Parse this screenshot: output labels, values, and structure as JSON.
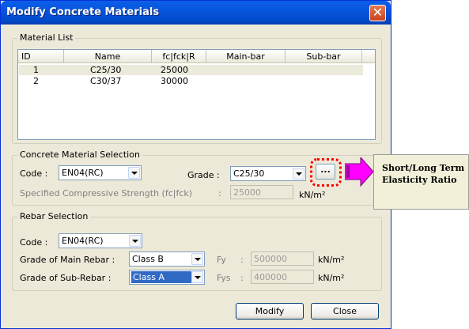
{
  "window": {
    "title": "Modify Concrete Materials",
    "close_glyph": "✕"
  },
  "material_list": {
    "group_label": "Material List",
    "columns": [
      "ID",
      "Name",
      "fc|fck|R",
      "Main-bar",
      "Sub-bar"
    ],
    "rows": [
      {
        "id": "1",
        "name": "C25/30",
        "fc": "25000",
        "main": "",
        "sub": ""
      },
      {
        "id": "2",
        "name": "C30/37",
        "fc": "30000",
        "main": "",
        "sub": ""
      }
    ]
  },
  "concrete": {
    "group_label": "Concrete Material Selection",
    "code_label": "Code  :",
    "code_value": "EN04(RC)",
    "grade_label": "Grade :",
    "grade_value": "C25/30",
    "dots_label": "...",
    "strength_label": "Specified Compressive Strength (fc|fck)",
    "colon": ":",
    "strength_value": "25000",
    "strength_unit": "kN/m²"
  },
  "rebar": {
    "group_label": "Rebar Selection",
    "code_label": "Code  :",
    "code_value": "EN04(RC)",
    "main_label": "Grade of Main Rebar :",
    "main_value": "Class B",
    "fy_label": "Fy",
    "fy_colon": ":",
    "fy_value": "500000",
    "fy_unit": "kN/m²",
    "sub_label": "Grade of Sub-Rebar :",
    "sub_value": "Class A",
    "fys_label": "Fys",
    "fys_colon": ":",
    "fys_value": "400000",
    "fys_unit": "kN/m²"
  },
  "buttons": {
    "modify": "Modify",
    "close": "Close"
  },
  "annotation": {
    "line1": "Short/Long Term",
    "line2": "Elasticity Ratio",
    "arrow_color": "#ff00ff",
    "highlight_color": "#ff0000"
  }
}
